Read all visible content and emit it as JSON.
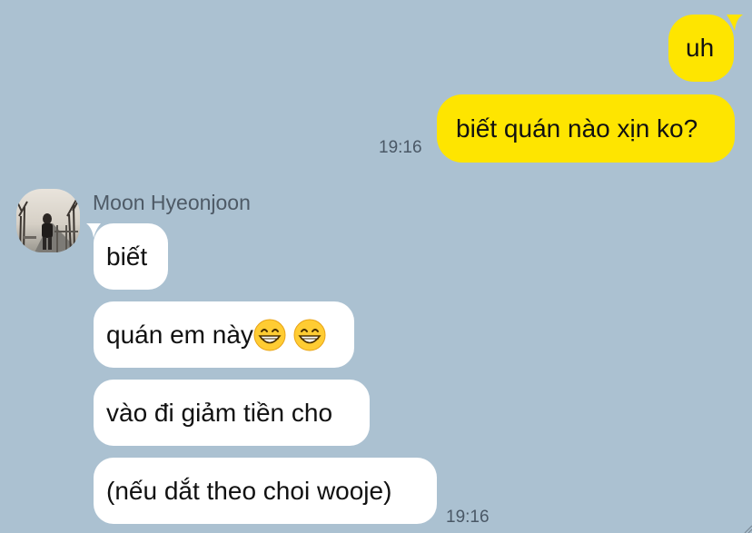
{
  "chat": {
    "outgoing": [
      {
        "text": "uh"
      },
      {
        "text": "biết quán nào xịn ko?",
        "time": "19:16"
      }
    ],
    "incoming_group": {
      "sender": "Moon Hyeonjoon",
      "messages": [
        {
          "text": "biết"
        },
        {
          "text": "quán em này",
          "emoji": [
            "grinning-face-emoji",
            "grinning-face-emoji"
          ]
        },
        {
          "text": "vào đi giảm tiền cho"
        },
        {
          "text": "(nếu dắt theo choi wooje)",
          "time": "19:16"
        }
      ]
    }
  },
  "colors": {
    "background": "#abc1d1",
    "outgoing_bubble": "#fee500",
    "incoming_bubble": "#ffffff",
    "timestamp": "#4a5866"
  }
}
